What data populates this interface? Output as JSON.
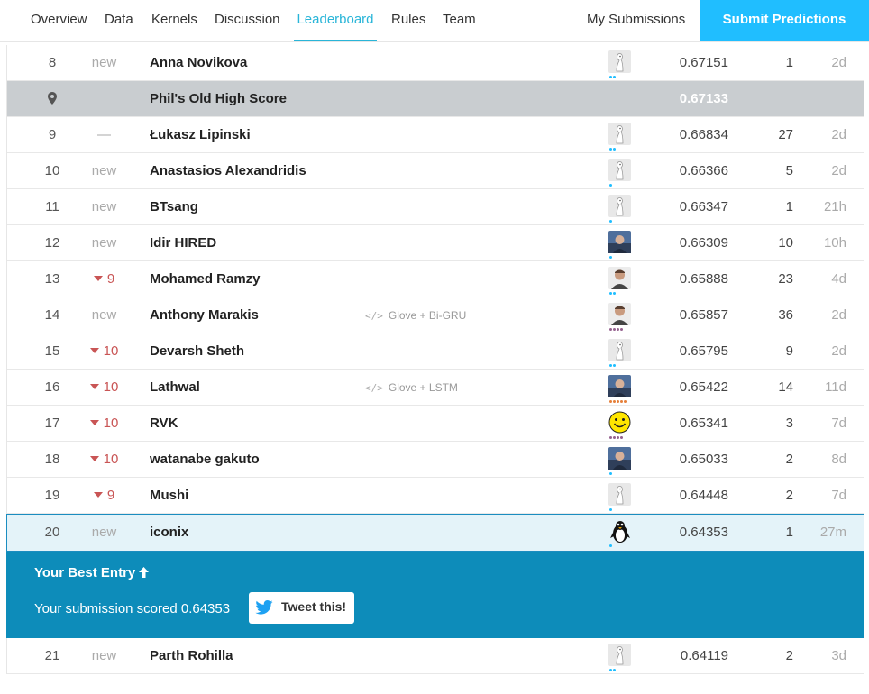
{
  "nav": {
    "tabs": [
      "Overview",
      "Data",
      "Kernels",
      "Discussion",
      "Leaderboard",
      "Rules",
      "Team"
    ],
    "active_tab": "Leaderboard",
    "my_submissions": "My Submissions",
    "submit": "Submit Predictions"
  },
  "highscore_row": {
    "name": "Phil's Old High Score",
    "score": "0.67133"
  },
  "rows_top": [
    {
      "rank": "8",
      "delta": "new",
      "delta_kind": "new",
      "name": "Anna Novikova",
      "kernel": "",
      "avatar": "default-avatar-icon",
      "tier": "novice",
      "score": "0.67151",
      "entries": "1",
      "last": "2d"
    }
  ],
  "rows_middle": [
    {
      "rank": "9",
      "delta": "—",
      "delta_kind": "same",
      "name": "Łukasz Lipinski",
      "kernel": "",
      "avatar": "default-avatar-icon",
      "tier": "novice",
      "score": "0.66834",
      "entries": "27",
      "last": "2d"
    },
    {
      "rank": "10",
      "delta": "new",
      "delta_kind": "new",
      "name": "Anastasios Alexandridis",
      "kernel": "",
      "avatar": "default-avatar-icon",
      "tier": "novice1",
      "score": "0.66366",
      "entries": "5",
      "last": "2d"
    },
    {
      "rank": "11",
      "delta": "new",
      "delta_kind": "new",
      "name": "BTsang",
      "kernel": "",
      "avatar": "default-avatar-icon",
      "tier": "novice1",
      "score": "0.66347",
      "entries": "1",
      "last": "21h"
    },
    {
      "rank": "12",
      "delta": "new",
      "delta_kind": "new",
      "name": "Idir HIRED",
      "kernel": "",
      "avatar": "photo-avatar-icon",
      "tier": "novice1",
      "score": "0.66309",
      "entries": "10",
      "last": "10h"
    },
    {
      "rank": "13",
      "delta": "9",
      "delta_kind": "down",
      "name": "Mohamed Ramzy",
      "kernel": "",
      "avatar": "face-avatar-icon",
      "tier": "novice",
      "score": "0.65888",
      "entries": "23",
      "last": "4d"
    },
    {
      "rank": "14",
      "delta": "new",
      "delta_kind": "new",
      "name": "Anthony Marakis",
      "kernel": "Glove + Bi-GRU",
      "avatar": "face-avatar-icon",
      "tier": "expert",
      "score": "0.65857",
      "entries": "36",
      "last": "2d"
    },
    {
      "rank": "15",
      "delta": "10",
      "delta_kind": "down",
      "name": "Devarsh Sheth",
      "kernel": "",
      "avatar": "default-avatar-icon",
      "tier": "novice",
      "score": "0.65795",
      "entries": "9",
      "last": "2d"
    },
    {
      "rank": "16",
      "delta": "10",
      "delta_kind": "down",
      "name": "Lathwal",
      "kernel": "Glove + LSTM",
      "avatar": "photo-avatar-icon",
      "tier": "master",
      "score": "0.65422",
      "entries": "14",
      "last": "11d"
    },
    {
      "rank": "17",
      "delta": "10",
      "delta_kind": "down",
      "name": "RVK",
      "kernel": "",
      "avatar": "smiley-avatar-icon",
      "tier": "expert",
      "score": "0.65341",
      "entries": "3",
      "last": "7d"
    },
    {
      "rank": "18",
      "delta": "10",
      "delta_kind": "down",
      "name": "watanabe gakuto",
      "kernel": "",
      "avatar": "photo-avatar-icon",
      "tier": "novice1",
      "score": "0.65033",
      "entries": "2",
      "last": "8d"
    },
    {
      "rank": "19",
      "delta": "9",
      "delta_kind": "down",
      "name": "Mushi",
      "kernel": "",
      "avatar": "default-avatar-icon",
      "tier": "novice1",
      "score": "0.64448",
      "entries": "2",
      "last": "7d"
    }
  ],
  "my_row": {
    "rank": "20",
    "delta": "new",
    "name": "iconix",
    "avatar": "penguin-avatar-icon",
    "score": "0.64353",
    "entries": "1",
    "last": "27m"
  },
  "best_entry": {
    "title": "Your Best Entry",
    "text": "Your submission scored 0.64353",
    "tweet": "Tweet this!"
  },
  "rows_bottom": [
    {
      "rank": "21",
      "delta": "new",
      "delta_kind": "new",
      "name": "Parth Rohilla",
      "kernel": "",
      "avatar": "default-avatar-icon",
      "tier": "novice",
      "score": "0.64119",
      "entries": "2",
      "last": "3d"
    }
  ],
  "colors": {
    "accent": "#20beff",
    "best_entry_bg": "#0d8cba",
    "down": "#c95555"
  }
}
